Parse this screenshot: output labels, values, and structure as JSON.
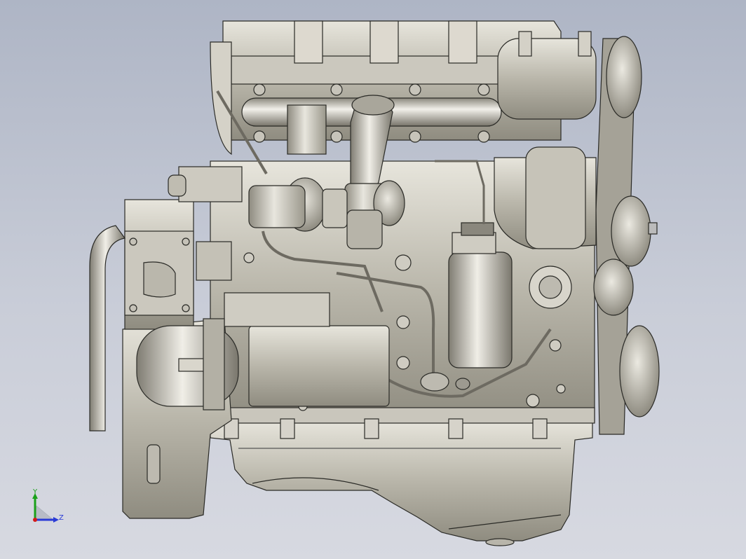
{
  "viewport": {
    "background_top": "#aeb5c5",
    "background_bottom": "#d7d9e1",
    "model": "engine-assembly-side-view"
  },
  "triad": {
    "y_label": "Y",
    "z_label": "Z",
    "y_color": "#1aa11a",
    "z_color": "#2a3bd6"
  }
}
